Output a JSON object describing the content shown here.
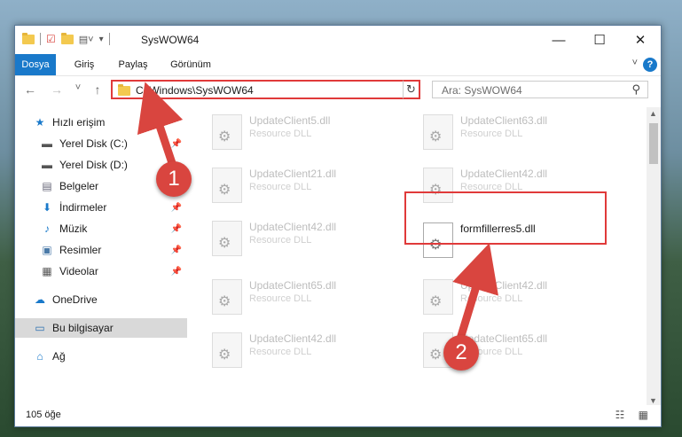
{
  "window": {
    "title": "SysWOW64",
    "controls": {
      "minimize": "—",
      "maximize": "☐",
      "close": "✕"
    }
  },
  "ribbon": {
    "tabs": [
      {
        "label": "Dosya",
        "active": true
      },
      {
        "label": "Giriş"
      },
      {
        "label": "Paylaş"
      },
      {
        "label": "Görünüm"
      }
    ],
    "help": "?",
    "expand_icon": "chevron-down-icon"
  },
  "navigation": {
    "back": "←",
    "forward": "→",
    "recent": "˅",
    "up": "↑",
    "address": "C:\\Windows\\SysWOW64",
    "address_dropdown": "˅",
    "refresh": "↻",
    "search_placeholder": "Ara: SysWOW64",
    "search_icon": "⚲"
  },
  "sidebar": {
    "items": [
      {
        "label": "Hızlı erişim",
        "icon": "star-icon",
        "glyph": "★",
        "color": "#1979ca"
      },
      {
        "label": "Yerel Disk (C:)",
        "icon": "drive-icon",
        "glyph": "▬",
        "pinned": true
      },
      {
        "label": "Yerel Disk (D:)",
        "icon": "drive-icon",
        "glyph": "▬"
      },
      {
        "label": "Belgeler",
        "icon": "document-icon",
        "glyph": "▤"
      },
      {
        "label": "İndirmeler",
        "icon": "download-icon",
        "glyph": "⬇",
        "pinned": true
      },
      {
        "label": "Müzik",
        "icon": "music-icon",
        "glyph": "♪",
        "pinned": true
      },
      {
        "label": "Resimler",
        "icon": "picture-icon",
        "glyph": "▣",
        "pinned": true
      },
      {
        "label": "Videolar",
        "icon": "video-icon",
        "glyph": "▦",
        "pinned": true
      },
      {
        "label": "OneDrive",
        "icon": "cloud-icon",
        "glyph": "☁"
      },
      {
        "label": "Bu bilgisayar",
        "icon": "computer-icon",
        "glyph": "▭",
        "selected": true
      },
      {
        "label": "Ağ",
        "icon": "network-icon",
        "glyph": "⌂"
      }
    ],
    "pin_glyph": "📌"
  },
  "files": [
    {
      "name": "UpdateClient5.dll",
      "desc": "Resource DLL"
    },
    {
      "name": "UpdateClient63.dll",
      "desc": "Resource DLL"
    },
    {
      "name": "UpdateClient21.dll",
      "desc": "Resource DLL"
    },
    {
      "name": "UpdateClient42.dll",
      "desc": "Resource DLL"
    },
    {
      "name": "UpdateClient42.dll",
      "desc": "Resource DLL"
    },
    {
      "name": "formfillerres5.dll",
      "desc": "",
      "highlighted": true
    },
    {
      "name": "UpdateClient65.dll",
      "desc": "Resource DLL"
    },
    {
      "name": "UpdateClient42.dll",
      "desc": "Resource DLL"
    },
    {
      "name": "UpdateClient42.dll",
      "desc": "Resource DLL"
    },
    {
      "name": "UpdateClient65.dll",
      "desc": "Resource DLL"
    }
  ],
  "gear_glyph": "⚙",
  "status": {
    "count": "105 öğe",
    "views": "☷ ▦"
  },
  "annotations": {
    "step1": "1",
    "step2": "2",
    "color": "#d9453f"
  }
}
